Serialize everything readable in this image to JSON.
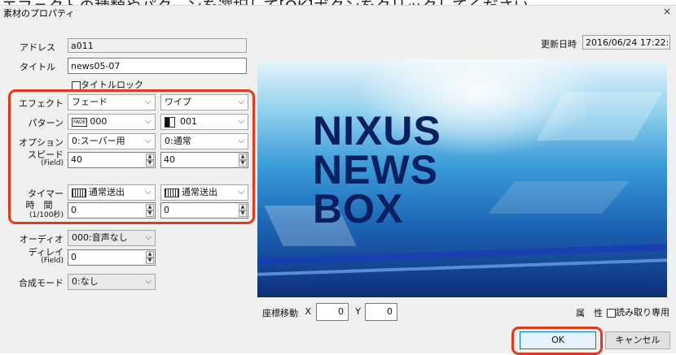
{
  "banner_text": "エフェクトの種類やパターンを選択して[OK]ボタンをクリックしてください",
  "window": {
    "title": "素材のプロパティ",
    "close_glyph": "×"
  },
  "address": {
    "label": "アドレス",
    "value": "a011"
  },
  "title_field": {
    "label": "タイトル",
    "value": "news05-07"
  },
  "title_lock": {
    "label": "タイトルロック",
    "checked": false
  },
  "updated": {
    "label": "更新日時",
    "value": "2016/06/24 17:22:38"
  },
  "effect": {
    "label": "エフェクト",
    "left": "フェード",
    "right": "ワイプ"
  },
  "pattern": {
    "label": "パターン",
    "left": "000",
    "left_icon_text": "FADE",
    "right": "001"
  },
  "option": {
    "label": "オプション",
    "left": "0:スーパー用",
    "right": "0:通常"
  },
  "speed": {
    "label": "スピード",
    "sub": "(Field)",
    "left": "40",
    "right": "40"
  },
  "timer": {
    "label": "タイマー",
    "left": "通常送出",
    "right": "通常送出"
  },
  "time": {
    "label": "時　間",
    "sub": "(1/100秒)",
    "left": "0",
    "right": "0"
  },
  "audio": {
    "label": "オーディオ",
    "value": "000:音声なし"
  },
  "delay": {
    "label": "ディレイ",
    "sub": "(Field)",
    "value": "0"
  },
  "blend": {
    "label": "合成モード",
    "value": "0:なし"
  },
  "preview": {
    "line1": "NIXUS",
    "line2": "NEWS",
    "line3": "BOX"
  },
  "coords": {
    "label": "座標移動",
    "x_label": "X",
    "x_value": "0",
    "y_label": "Y",
    "y_value": "0"
  },
  "attribute": {
    "label": "属　性",
    "readonly_label": "読み取り専用",
    "checked": false
  },
  "buttons": {
    "ok": "OK",
    "cancel": "キャンセル"
  },
  "colors": {
    "highlight": "#e8381a",
    "dialog_bg": "#f0f0f0",
    "preview_text": "#0a1f5e"
  }
}
